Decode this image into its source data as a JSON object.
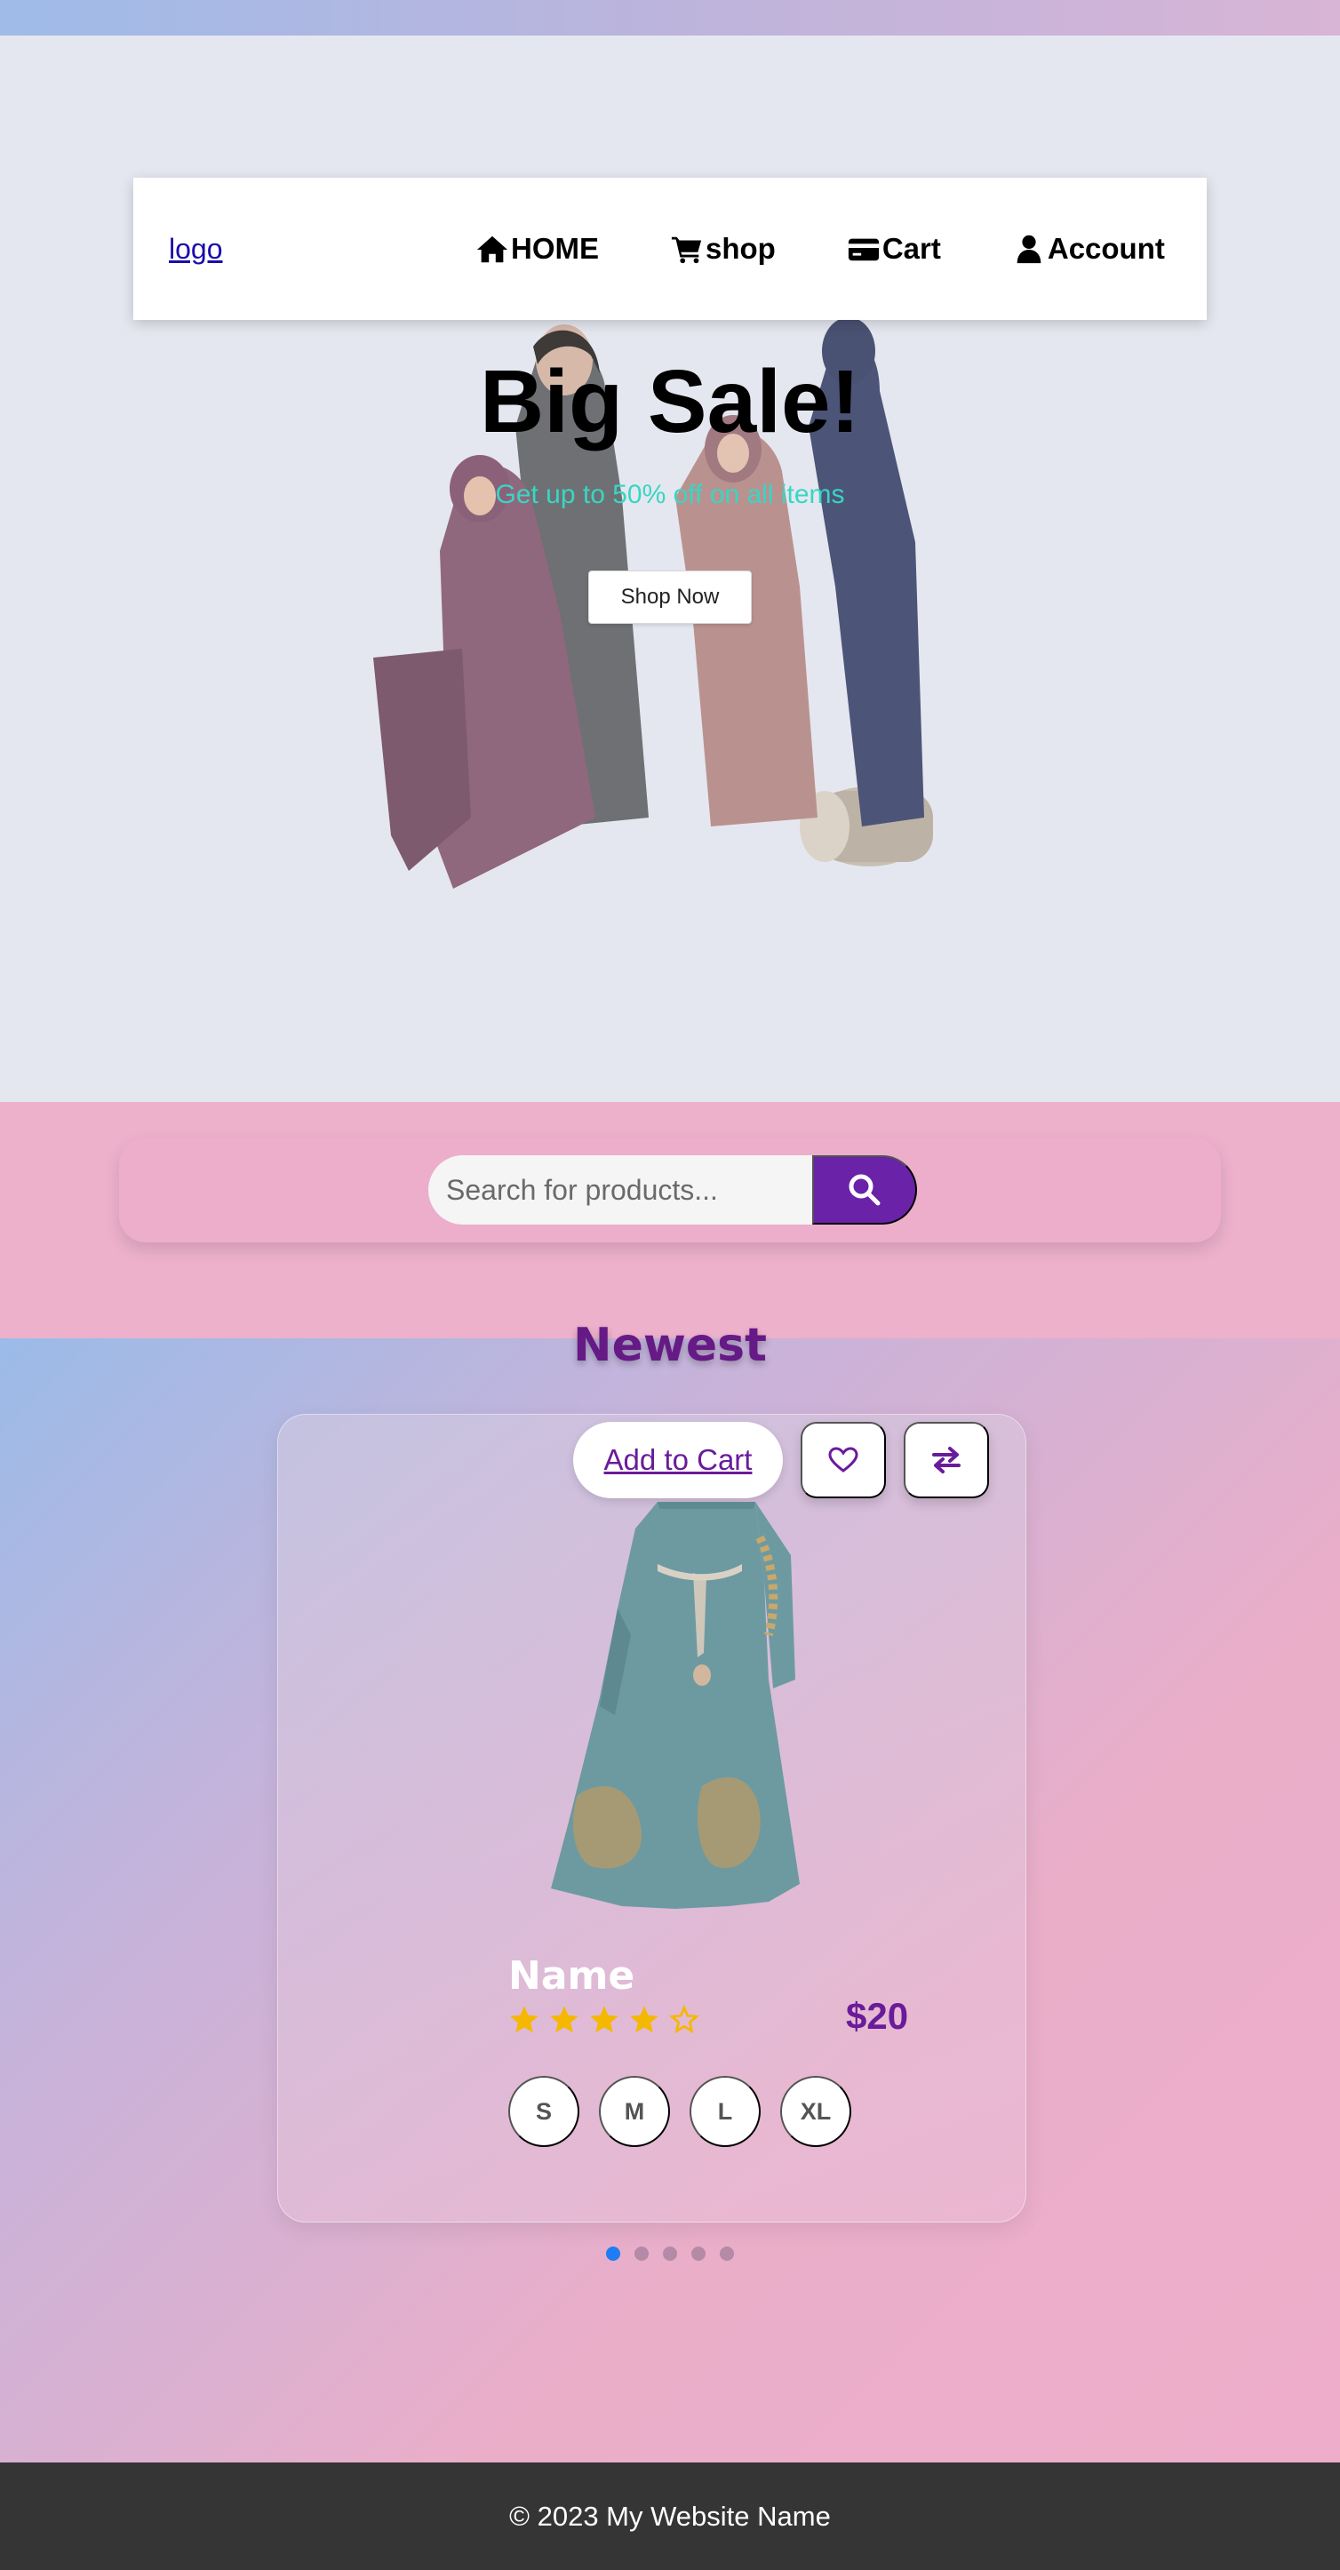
{
  "nav": {
    "logo": "logo",
    "items": [
      {
        "label": "HOME",
        "icon": "home-icon"
      },
      {
        "label": "shop",
        "icon": "cart-icon"
      },
      {
        "label": "Cart",
        "icon": "credit-card-icon"
      },
      {
        "label": "Account",
        "icon": "user-icon"
      }
    ]
  },
  "hero": {
    "title": "Big Sale!",
    "subtitle": "Get up to 50% off on all items",
    "cta": "Shop Now"
  },
  "search": {
    "placeholder": "Search for products...",
    "button_icon": "search-icon"
  },
  "products": {
    "section_title": "Newest",
    "card": {
      "add_to_cart": "Add to Cart",
      "wishlist_icon": "heart-icon",
      "compare_icon": "exchange-icon",
      "name": "Name",
      "rating": 4,
      "rating_max": 5,
      "price": "$20",
      "sizes": [
        "S",
        "M",
        "L",
        "XL"
      ]
    },
    "carousel": {
      "pages": 5,
      "active": 1
    }
  },
  "footer": {
    "text": "© 2023 My Website Name"
  },
  "colors": {
    "accent": "#6a22a8",
    "title": "#651a86",
    "subtitle": "#38d6c4",
    "star": "#f5b800",
    "footer_bg": "#353535",
    "dot_active": "#1f7cf2"
  }
}
